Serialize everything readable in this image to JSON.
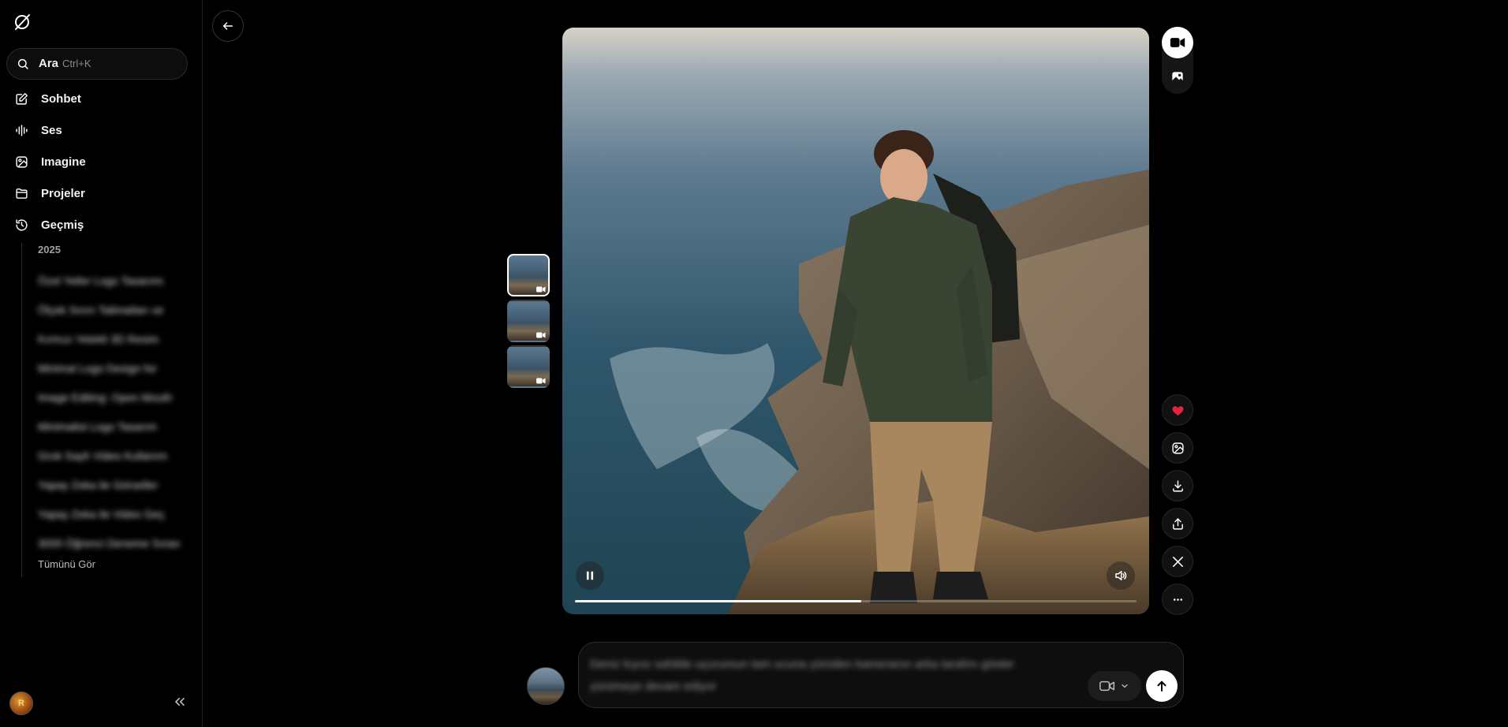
{
  "sidebar": {
    "search": {
      "label": "Ara",
      "shortcut": "Ctrl+K"
    },
    "nav": [
      {
        "label": "Sohbet",
        "icon": "edit-icon"
      },
      {
        "label": "Ses",
        "icon": "waveform-icon"
      },
      {
        "label": "Imagine",
        "icon": "image-sparkle-icon"
      },
      {
        "label": "Projeler",
        "icon": "folder-icon"
      },
      {
        "label": "Geçmiş",
        "icon": "history-icon"
      }
    ],
    "history": {
      "year": "2025",
      "items": [
        "Özel Yeller Logo Tasarımı",
        "Ölçek Sınırı Talimatları ve",
        "Kırmızı Yelekli 3D Resim",
        "Minimal Logo Design for",
        "Image Editing: Open Mouth",
        "Minimalist Logo Tasarım",
        "Grok Sayfı Video Kullanım",
        "Yapay Zeka ile Görseller",
        "Yapay Zeka ile Video Geç",
        "3000 Öğrenci Deneme Sınavı"
      ],
      "see_all": "Tümünü Gör"
    },
    "avatar_initials": "R"
  },
  "video": {
    "progress": 0.51
  },
  "composer": {
    "text": "Deniz kıyısı sahilde uçurumun tam ucuna yürüden kameranın arka tarafını göster yürümeye devam ediyor"
  },
  "colors": {
    "accent_heart": "#e5243b",
    "background": "#000000",
    "surface": "#0e0e0e"
  }
}
